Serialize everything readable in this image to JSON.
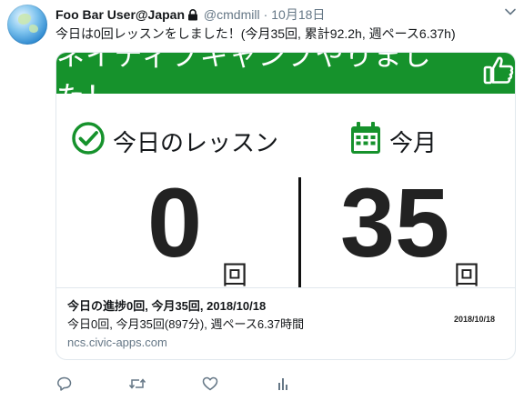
{
  "tweet": {
    "user_name": "Foo Bar User@Japan",
    "handle": "@cmdmill",
    "separator": "·",
    "date": "10月18日",
    "text": "今日は0回レッスンをしました！(今月35回, 累計92.2h, 週ペース6.37h)"
  },
  "card": {
    "banner_text": "ネイティブキャンプやりました！",
    "left_title": "今日のレッスン",
    "left_value": "0",
    "left_unit": "回",
    "right_title": "今月",
    "right_value": "35",
    "right_unit": "回",
    "image_date": "2018/10/18",
    "footer_title": "今日の進捗0回, 今月35回, 2018/10/18",
    "footer_desc": "今日0回, 今月35回(897分), 週ペース6.37時間",
    "footer_domain": "ncs.civic-apps.com",
    "accent_color": "#16922c"
  },
  "icons": {
    "lock": "lock-icon",
    "caret": "chevron-down-icon",
    "thumbs_up": "thumbs-up-icon",
    "check": "check-circle-icon",
    "calendar": "calendar-icon",
    "reply": "reply-icon",
    "retweet": "retweet-icon",
    "like": "heart-icon",
    "analytics": "analytics-icon"
  }
}
